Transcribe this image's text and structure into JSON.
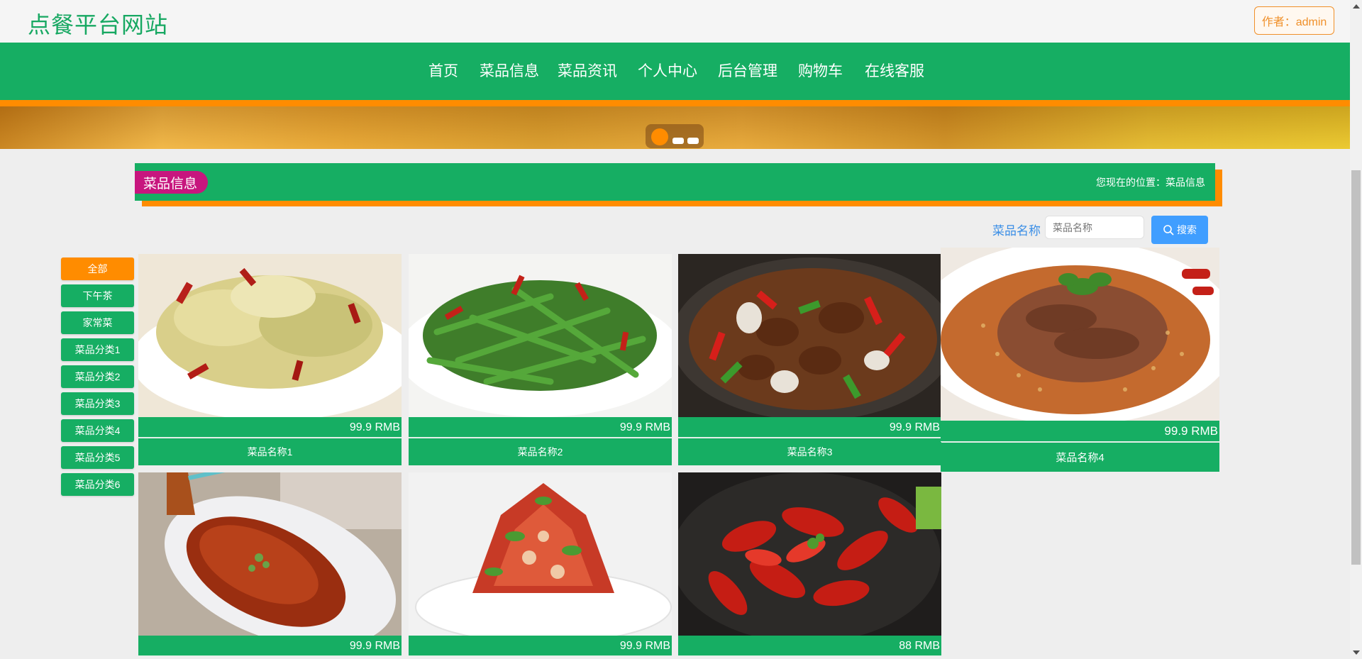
{
  "header": {
    "site_title": "点餐平台网站",
    "author": "作者：admin"
  },
  "nav": {
    "items": [
      "首页",
      "菜品信息",
      "菜品资讯",
      "个人中心",
      "后台管理",
      "购物车",
      "在线客服"
    ]
  },
  "section": {
    "title": "菜品信息",
    "location": "您现在的位置：菜品信息"
  },
  "search": {
    "label": "菜品名称",
    "placeholder": "菜品名称",
    "value": "",
    "button": "搜索"
  },
  "categories": {
    "items": [
      "全部",
      "下午茶",
      "家常菜",
      "菜品分类1",
      "菜品分类2",
      "菜品分类3",
      "菜品分类4",
      "菜品分类5",
      "菜品分类6"
    ],
    "active_index": 0
  },
  "products": [
    {
      "name": "菜品名称1",
      "price": "99.9 RMB",
      "image": "stir-fried-cabbage-photo"
    },
    {
      "name": "菜品名称2",
      "price": "99.9 RMB",
      "image": "dry-fried-green-beans-photo"
    },
    {
      "name": "菜品名称3",
      "price": "99.9 RMB",
      "image": "braised-chicken-pot-photo"
    },
    {
      "name": "菜品名称4",
      "price": "99.9 RMB",
      "image": "sliced-beef-sesame-photo"
    },
    {
      "name": "",
      "price": "99.9 RMB",
      "image": "braised-fish-photo"
    },
    {
      "name": "",
      "price": "99.9 RMB",
      "image": "spicy-tofu-salad-photo"
    },
    {
      "name": "",
      "price": "88 RMB",
      "image": "crayfish-photo"
    }
  ],
  "colors": {
    "primary": "#16ae63",
    "accent": "#ff8c00",
    "tag": "#c7167e",
    "search_button": "#409eff",
    "link": "#3a8ee6"
  }
}
